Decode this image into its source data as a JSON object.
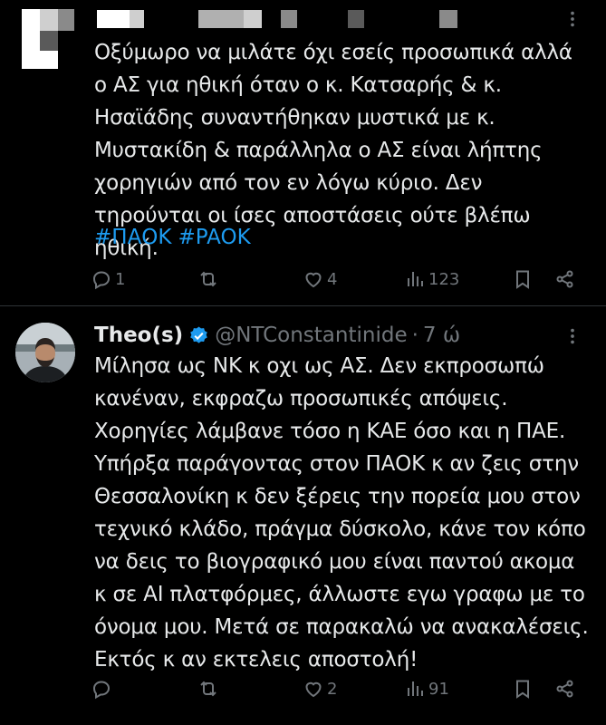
{
  "tweet1": {
    "body": "Οξύμωρο να μιλάτε όχι εσείς προσωπικά αλλά ο ΑΣ για ηθική όταν ο κ. Κατσαρής & κ. Ησαϊάδης συναντήθηκαν μυστικά με κ. Μυστακίδη & παράλληλα ο ΑΣ είναι λήπτης χορηγιών από τον εν λόγω κύριο. Δεν τηρούνται οι ίσες αποστάσεις ούτε βλέπω ηθική.",
    "hashtags": [
      "#ΠΑΟΚ",
      "#PAOK"
    ],
    "actions": {
      "replies": "1",
      "reposts": "",
      "likes": "4",
      "views": "123"
    }
  },
  "tweet2": {
    "name": "Theo(s)",
    "handle": "@NTConstantinide",
    "separator": "·",
    "time": "7 ώ",
    "body": "Μίλησα ως ΝΚ κ οχι ως ΑΣ. Δεν εκπροσωπώ κανέναν, εκφραζω προσωπικές απόψεις. Χορηγίες λάμβανε τόσο η ΚΑΕ όσο και η ΠΑΕ. Υπήρξα παράγοντας στον ΠΑΟΚ κ αν ζεις στην Θεσσαλονίκη κ δεν ξέρεις την πορεία μου στον τεχνικό κλάδο, πράγμα δύσκολο, κάνε τον κόπο να δεις το βιογραφικό μου είναι παντού ακομα κ σε AI πλατφόρμες, άλλωστε εγω γραφω με το όνομα μου. Μετά σε παρακαλώ να ανακαλέσεις. Εκτός κ αν εκτελεις αποστολή!",
    "actions": {
      "replies": "",
      "reposts": "",
      "likes": "2",
      "views": "91"
    }
  },
  "colors": {
    "background": "#000000",
    "text": "#e7e9ea",
    "muted": "#71767b",
    "link": "#1d9bf0",
    "verified": "#1d9bf0"
  },
  "icons": [
    "reply-icon",
    "repost-icon",
    "like-icon",
    "views-icon",
    "bookmark-icon",
    "share-icon",
    "more-icon",
    "verified-badge-icon"
  ]
}
